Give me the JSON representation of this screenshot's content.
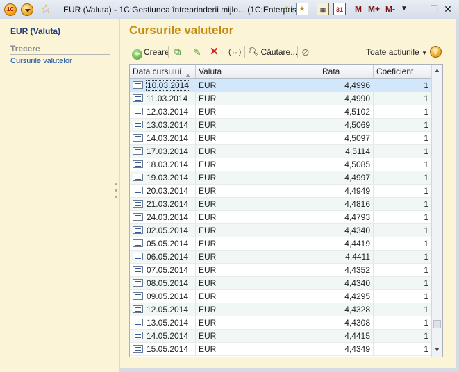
{
  "window": {
    "title": "EUR (Valuta) - 1C:Gestiunea întreprinderii mijlo...  (1C:Enterprise)",
    "logo_text": "1C",
    "m_buttons": [
      "M",
      "M+",
      "M-"
    ],
    "icons": [
      "app-logo-icon",
      "dropdown-menu-icon",
      "favorites-star-icon",
      "add-favorite-icon",
      "favorites-list-icon",
      "calculator-icon",
      "calendar-icon",
      "minimize-icon",
      "maximize-icon",
      "close-icon"
    ]
  },
  "sidebar": {
    "title": "EUR (Valuta)",
    "section": "Trecere",
    "links": [
      "Cursurile valutelor"
    ]
  },
  "main": {
    "title": "Cursurile valutelor",
    "toolbar": {
      "create_label": "Creare",
      "search_label": "Căutare...",
      "actions_label": "Toate acțiunile",
      "help_label": "?",
      "move_label": "(↔)"
    },
    "table": {
      "columns": [
        "Data cursului",
        "Valuta",
        "Rata",
        "Coeficient"
      ],
      "rows": [
        {
          "date": "10.03.2014",
          "currency": "EUR",
          "rate": "4,4996",
          "coef": "1",
          "selected": true
        },
        {
          "date": "11.03.2014",
          "currency": "EUR",
          "rate": "4,4990",
          "coef": "1"
        },
        {
          "date": "12.03.2014",
          "currency": "EUR",
          "rate": "4,5102",
          "coef": "1"
        },
        {
          "date": "13.03.2014",
          "currency": "EUR",
          "rate": "4,5069",
          "coef": "1"
        },
        {
          "date": "14.03.2014",
          "currency": "EUR",
          "rate": "4,5097",
          "coef": "1"
        },
        {
          "date": "17.03.2014",
          "currency": "EUR",
          "rate": "4,5114",
          "coef": "1"
        },
        {
          "date": "18.03.2014",
          "currency": "EUR",
          "rate": "4,5085",
          "coef": "1"
        },
        {
          "date": "19.03.2014",
          "currency": "EUR",
          "rate": "4,4997",
          "coef": "1"
        },
        {
          "date": "20.03.2014",
          "currency": "EUR",
          "rate": "4,4949",
          "coef": "1"
        },
        {
          "date": "21.03.2014",
          "currency": "EUR",
          "rate": "4,4816",
          "coef": "1"
        },
        {
          "date": "24.03.2014",
          "currency": "EUR",
          "rate": "4,4793",
          "coef": "1"
        },
        {
          "date": "02.05.2014",
          "currency": "EUR",
          "rate": "4,4340",
          "coef": "1"
        },
        {
          "date": "05.05.2014",
          "currency": "EUR",
          "rate": "4,4419",
          "coef": "1"
        },
        {
          "date": "06.05.2014",
          "currency": "EUR",
          "rate": "4,4411",
          "coef": "1"
        },
        {
          "date": "07.05.2014",
          "currency": "EUR",
          "rate": "4,4352",
          "coef": "1"
        },
        {
          "date": "08.05.2014",
          "currency": "EUR",
          "rate": "4,4340",
          "coef": "1"
        },
        {
          "date": "09.05.2014",
          "currency": "EUR",
          "rate": "4,4295",
          "coef": "1"
        },
        {
          "date": "12.05.2014",
          "currency": "EUR",
          "rate": "4,4328",
          "coef": "1"
        },
        {
          "date": "13.05.2014",
          "currency": "EUR",
          "rate": "4,4308",
          "coef": "1"
        },
        {
          "date": "14.05.2014",
          "currency": "EUR",
          "rate": "4,4415",
          "coef": "1"
        },
        {
          "date": "15.05.2014",
          "currency": "EUR",
          "rate": "4,4349",
          "coef": "1"
        }
      ]
    }
  },
  "colors": {
    "title_accent": "#c58a0e",
    "panel_bg": "#fbf4d6",
    "selected_row": "#d3e7fb",
    "link": "#1c4fa0"
  }
}
